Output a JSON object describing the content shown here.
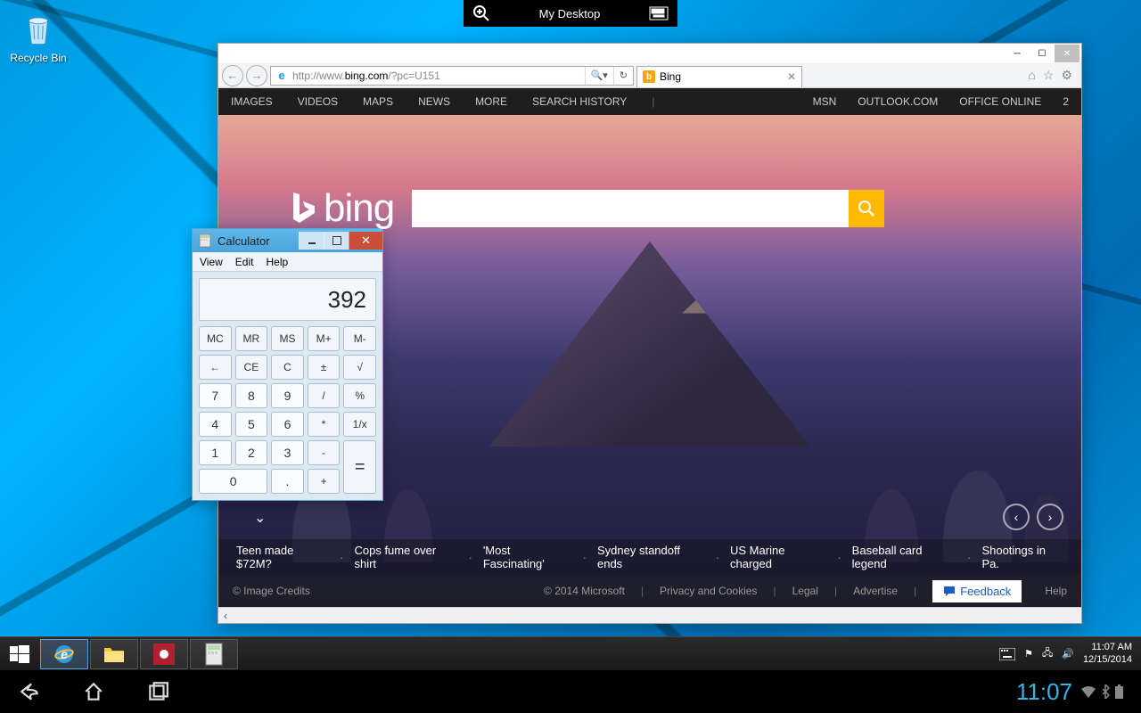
{
  "desktop": {
    "recycle_bin": "Recycle Bin"
  },
  "remote_bar": {
    "title": "My Desktop"
  },
  "ie": {
    "url_prefix": "http://www.",
    "url_host": "bing.com",
    "url_suffix": "/?pc=U151",
    "tab_title": "Bing",
    "search_glyph": "🔍",
    "refresh_glyph": "↻"
  },
  "bing": {
    "nav": [
      "IMAGES",
      "VIDEOS",
      "MAPS",
      "NEWS",
      "MORE",
      "SEARCH HISTORY"
    ],
    "nav_right": [
      "MSN",
      "OUTLOOK.COM",
      "OFFICE ONLINE"
    ],
    "count": "2",
    "logo_text": "bing",
    "search_placeholder": "",
    "news": [
      "Teen made $72M?",
      "Cops fume over shirt",
      "'Most Fascinating'",
      "Sydney standoff ends",
      "US Marine charged",
      "Baseball card legend",
      "Shootings in Pa."
    ],
    "footer": {
      "credits": "© Image Credits",
      "copyright": "© 2014 Microsoft",
      "links": [
        "Privacy and Cookies",
        "Legal",
        "Advertise"
      ],
      "help": "Help",
      "feedback": "Feedback"
    }
  },
  "calc": {
    "title": "Calculator",
    "menu": [
      "View",
      "Edit",
      "Help"
    ],
    "display": "392",
    "mem_row": [
      "MC",
      "MR",
      "MS",
      "M+",
      "M-"
    ],
    "row2": [
      "←",
      "CE",
      "C",
      "±",
      "√"
    ],
    "row3": [
      "7",
      "8",
      "9",
      "/",
      "%"
    ],
    "row4": [
      "4",
      "5",
      "6",
      "*",
      "1/x"
    ],
    "row5": [
      "1",
      "2",
      "3",
      "-"
    ],
    "row6_0": "0",
    "row6_dot": ".",
    "row6_plus": "+",
    "equals": "="
  },
  "taskbar": {
    "time": "11:07 AM",
    "date": "12/15/2014"
  },
  "android": {
    "clock": "11:07"
  }
}
